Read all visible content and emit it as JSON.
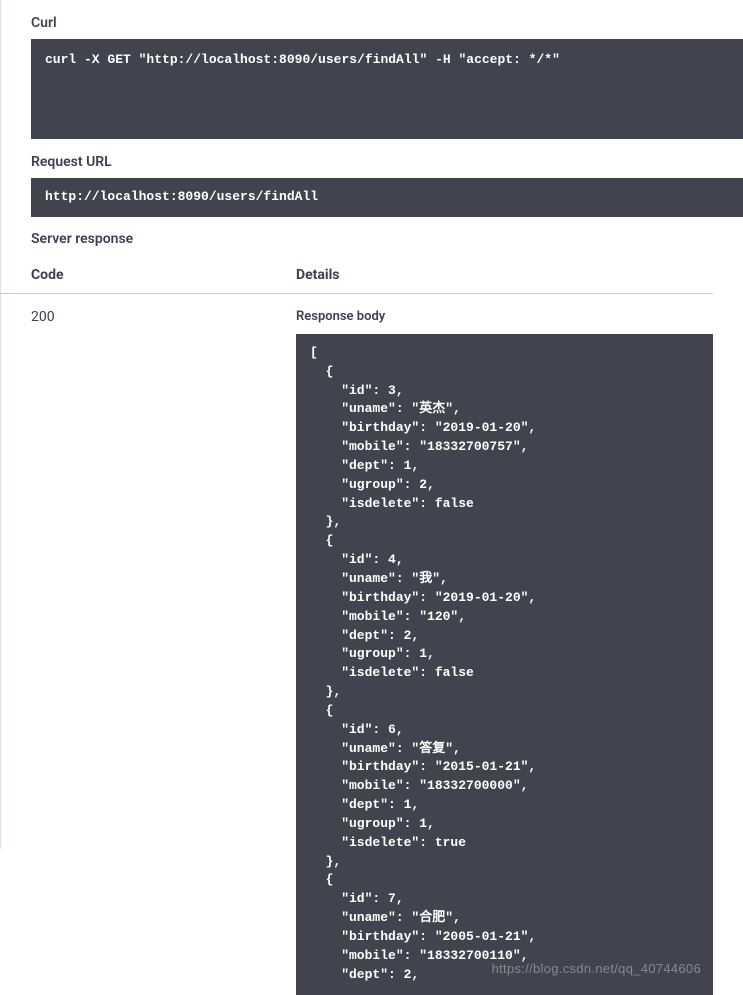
{
  "sections": {
    "curl_label": "Curl",
    "curl_command": "curl -X GET \"http://localhost:8090/users/findAll\" -H \"accept: */*\"",
    "request_url_label": "Request URL",
    "request_url": "http://localhost:8090/users/findAll",
    "server_response_label": "Server response",
    "code_header": "Code",
    "details_header": "Details",
    "code_value": "200",
    "response_body_label": "Response body",
    "response_body_text": "[\n  {\n    \"id\": 3,\n    \"uname\": \"英杰\",\n    \"birthday\": \"2019-01-20\",\n    \"mobile\": \"18332700757\",\n    \"dept\": 1,\n    \"ugroup\": 2,\n    \"isdelete\": false\n  },\n  {\n    \"id\": 4,\n    \"uname\": \"我\",\n    \"birthday\": \"2019-01-20\",\n    \"mobile\": \"120\",\n    \"dept\": 2,\n    \"ugroup\": 1,\n    \"isdelete\": false\n  },\n  {\n    \"id\": 6,\n    \"uname\": \"答复\",\n    \"birthday\": \"2015-01-21\",\n    \"mobile\": \"18332700000\",\n    \"dept\": 1,\n    \"ugroup\": 1,\n    \"isdelete\": true\n  },\n  {\n    \"id\": 7,\n    \"uname\": \"合肥\",\n    \"birthday\": \"2005-01-21\",\n    \"mobile\": \"18332700110\",\n    \"dept\": 2,",
    "watermark": "https://blog.csdn.net/qq_40744606"
  },
  "chart_data": {
    "type": "table",
    "title": "Users findAll response",
    "columns": [
      "id",
      "uname",
      "birthday",
      "mobile",
      "dept",
      "ugroup",
      "isdelete"
    ],
    "rows": [
      [
        3,
        "英杰",
        "2019-01-20",
        "18332700757",
        1,
        2,
        false
      ],
      [
        4,
        "我",
        "2019-01-20",
        "120",
        2,
        1,
        false
      ],
      [
        6,
        "答复",
        "2015-01-21",
        "18332700000",
        1,
        1,
        true
      ],
      [
        7,
        "合肥",
        "2005-01-21",
        "18332700110",
        2,
        null,
        null
      ]
    ]
  }
}
